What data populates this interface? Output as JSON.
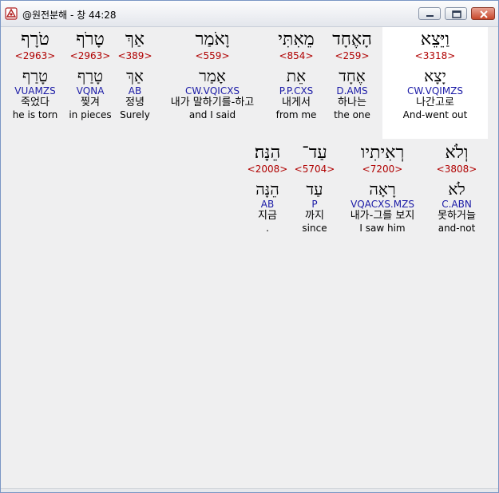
{
  "window": {
    "title": "@원전분해 - 창 44:28",
    "buttons": {
      "minimize": "minimize",
      "maximize": "maximize",
      "close": "close"
    }
  },
  "row1": [
    {
      "hebrew": "טֹרָף",
      "strong": "<2963>",
      "hebrew_lex": "טָרַף",
      "parse": "VUAMZS",
      "korean": "죽었다",
      "english": "he is torn"
    },
    {
      "hebrew": "טָרֹף",
      "strong": "<2963>",
      "hebrew_lex": "טָרַף",
      "parse": "VQNA",
      "korean": "찢겨",
      "english": "in pieces"
    },
    {
      "hebrew": "אַךְ",
      "strong": "<389>",
      "hebrew_lex": "אַךְ",
      "parse": "AB",
      "korean": "정녕",
      "english": "Surely"
    },
    {
      "hebrew": "וָאֹמַר",
      "strong": "<559>",
      "hebrew_lex": "אָמַר",
      "parse": "CW.VQICXS",
      "korean": "내가 말하기를-하고",
      "english": "and I said"
    },
    {
      "hebrew": "מֵאִתִּי",
      "strong": "<854>",
      "hebrew_lex": "אֵת",
      "parse": "P.P.CXS",
      "korean": "내게서",
      "english": "from me"
    },
    {
      "hebrew": "הָאֶחָד",
      "strong": "<259>",
      "hebrew_lex": "אֶחָד",
      "parse": "D.AMS",
      "korean": "하나는",
      "english": "the one"
    },
    {
      "hebrew": "וַיֵּצֵא",
      "strong": "<3318>",
      "hebrew_lex": "יָצָא",
      "parse": "CW.VQIMZS",
      "korean": "나간고로",
      "english": "And-went out"
    }
  ],
  "row2": [
    {
      "hebrew": "הֵנָּה׃",
      "strong": "<2008>",
      "hebrew_lex": "הֵנָּה",
      "parse": "AB",
      "korean": "지금",
      "english": "."
    },
    {
      "hebrew": "עַד־",
      "strong": "<5704>",
      "hebrew_lex": "עַד",
      "parse": "P",
      "korean": "까지",
      "english": "since"
    },
    {
      "hebrew": "רְאִיתִיו",
      "strong": "<7200>",
      "hebrew_lex": "רָאָה",
      "parse": "VQACXS.MZS",
      "korean": "내가-그를 보지",
      "english": "I saw him"
    },
    {
      "hebrew": "וְלֹא",
      "strong": "<3808>",
      "hebrew_lex": "לֹא",
      "parse": "C.ABN",
      "korean": "못하거늘",
      "english": "and-not"
    }
  ]
}
